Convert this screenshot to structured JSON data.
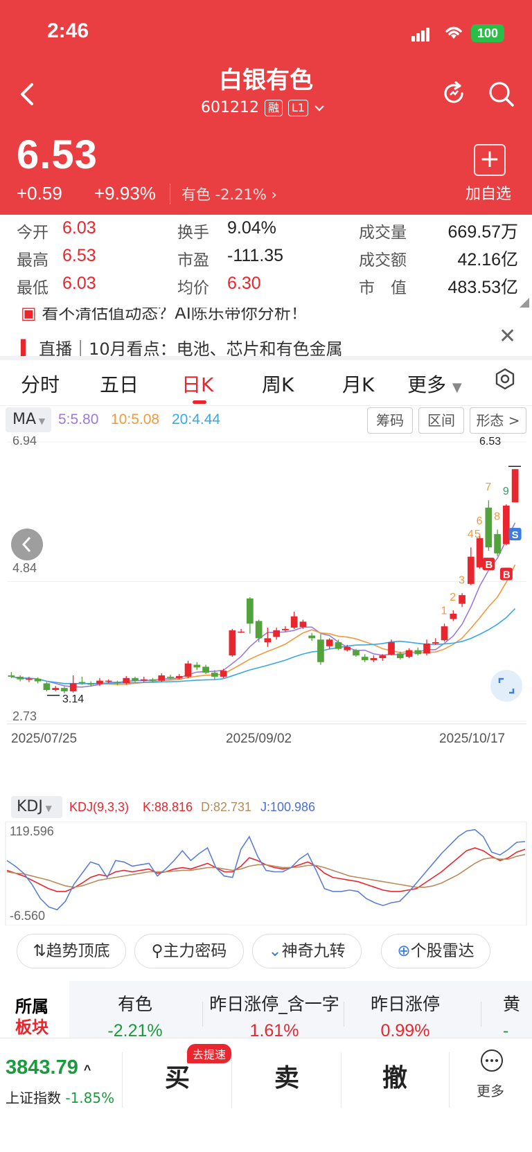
{
  "status": {
    "time": "2:46",
    "battery": "100"
  },
  "header": {
    "title": "白银有色",
    "code": "601212",
    "tags": [
      "融",
      "L1"
    ],
    "price": "6.53",
    "change_abs": "+0.59",
    "change_pct": "+9.93%",
    "sector_link": "有色  -2.21%",
    "add_label": "加自选"
  },
  "stats": [
    {
      "k": "今开",
      "v": "6.03",
      "color": "red"
    },
    {
      "k": "最高",
      "v": "6.53",
      "color": "red"
    },
    {
      "k": "最低",
      "v": "6.03",
      "color": "red"
    },
    {
      "k": "换手",
      "v": "9.04%",
      "color": "dark"
    },
    {
      "k": "市盈",
      "v": "-111.35",
      "color": "dark"
    },
    {
      "k": "均价",
      "v": "6.30",
      "color": "red"
    },
    {
      "k": "成交量",
      "v": "669.57万",
      "color": "dark"
    },
    {
      "k": "成交额",
      "v": "42.16亿",
      "color": "dark"
    },
    {
      "k": "市　值",
      "v": "483.53亿",
      "color": "dark"
    }
  ],
  "news": [
    "看不清估值动态？AI陈乐带你分析！",
    "直播｜10月看点：电池、芯片和有色金属"
  ],
  "tabs": [
    "分时",
    "五日",
    "日K",
    "周K",
    "月K",
    "更多"
  ],
  "ma": {
    "label": "MA",
    "ma5": "5:5.80",
    "ma10": "10:5.08",
    "ma20": "20:4.44"
  },
  "chips": [
    "筹码",
    "区间",
    "形态 >"
  ],
  "kdj": {
    "label": "KDJ",
    "params": "KDJ(9,3,3)",
    "k": "K:88.816",
    "d": "D:82.731",
    "j": "J:100.986"
  },
  "tools": [
    "趋势顶底",
    "主力密码",
    "神奇九转",
    "个股雷达"
  ],
  "sector": {
    "title": [
      "所属",
      "板块"
    ],
    "items": [
      {
        "name": "有色",
        "pct": "-2.21%",
        "color": "green"
      },
      {
        "name": "昨日涨停_含一字",
        "pct": "1.61%",
        "color": "red"
      },
      {
        "name": "昨日涨停",
        "pct": "0.99%",
        "color": "red"
      },
      {
        "name": "黄",
        "pct": "-",
        "color": "green"
      }
    ]
  },
  "bottom": {
    "index_value": "3843.79",
    "index_name": "上证指数",
    "index_change": "-1.85%",
    "buy": "买",
    "sell": "卖",
    "cancel": "撤",
    "fast_badge": "去提速",
    "more": "更多"
  },
  "chart_data": [
    {
      "type": "candlestick",
      "y_axis_labels": [
        "6.94",
        "4.84",
        "2.73"
      ],
      "y_range": [
        2.73,
        6.94
      ],
      "x_axis_labels": [
        "2025/07/25",
        "2025/09/02",
        "2025/10/17"
      ],
      "annotations": {
        "high_label": "6.53",
        "low_label": "3.14",
        "nine_turn": [
          "1",
          "2",
          "3",
          "4",
          "5",
          "6",
          "7",
          "8",
          "9"
        ],
        "signals": [
          "B",
          "B",
          "S"
        ]
      },
      "candles": [
        [
          3.42,
          3.4,
          3.47,
          3.38
        ],
        [
          3.4,
          3.36,
          3.42,
          3.33
        ],
        [
          3.36,
          3.37,
          3.4,
          3.32
        ],
        [
          3.37,
          3.33,
          3.39,
          3.3
        ],
        [
          3.3,
          3.2,
          3.32,
          3.18
        ],
        [
          3.2,
          3.23,
          3.26,
          3.18
        ],
        [
          3.23,
          3.18,
          3.25,
          3.15
        ],
        [
          3.18,
          3.3,
          3.42,
          3.16
        ],
        [
          3.32,
          3.31,
          3.4,
          3.28
        ],
        [
          3.3,
          3.28,
          3.33,
          3.25
        ],
        [
          3.29,
          3.34,
          3.38,
          3.26
        ],
        [
          3.33,
          3.34,
          3.36,
          3.3
        ],
        [
          3.32,
          3.3,
          3.34,
          3.27
        ],
        [
          3.3,
          3.38,
          3.41,
          3.28
        ],
        [
          3.38,
          3.34,
          3.4,
          3.32
        ],
        [
          3.34,
          3.36,
          3.4,
          3.32
        ],
        [
          3.36,
          3.34,
          3.38,
          3.31
        ],
        [
          3.34,
          3.42,
          3.45,
          3.32
        ],
        [
          3.4,
          3.38,
          3.43,
          3.36
        ],
        [
          3.38,
          3.41,
          3.44,
          3.36
        ],
        [
          3.4,
          3.6,
          3.64,
          3.38
        ],
        [
          3.58,
          3.54,
          3.62,
          3.5
        ],
        [
          3.55,
          3.46,
          3.58,
          3.44
        ],
        [
          3.46,
          3.4,
          3.5,
          3.36
        ],
        [
          3.4,
          3.49,
          3.52,
          3.38
        ],
        [
          3.72,
          4.1,
          4.12,
          3.7
        ],
        [
          4.08,
          4.08,
          4.12,
          4.06
        ],
        [
          4.58,
          4.2,
          4.6,
          4.05
        ],
        [
          4.24,
          3.98,
          4.26,
          3.92
        ],
        [
          3.92,
          3.98,
          4.14,
          3.85
        ],
        [
          4.0,
          4.1,
          4.14,
          3.96
        ],
        [
          4.1,
          4.12,
          4.16,
          4.08
        ],
        [
          4.14,
          4.31,
          4.38,
          4.12
        ],
        [
          4.15,
          4.23,
          4.26,
          4.12
        ],
        [
          4.02,
          3.98,
          4.06,
          3.94
        ],
        [
          3.96,
          3.62,
          4.04,
          3.58
        ],
        [
          3.86,
          3.96,
          3.98,
          3.82
        ],
        [
          3.92,
          3.82,
          3.96,
          3.8
        ],
        [
          3.8,
          3.85,
          3.88,
          3.78
        ],
        [
          3.8,
          3.72,
          3.82,
          3.7
        ],
        [
          3.7,
          3.65,
          3.74,
          3.62
        ],
        [
          3.65,
          3.68,
          3.72,
          3.62
        ],
        [
          3.68,
          3.72,
          3.74,
          3.64
        ],
        [
          3.73,
          3.92,
          3.96,
          3.72
        ],
        [
          3.75,
          3.68,
          3.78,
          3.66
        ],
        [
          3.7,
          3.8,
          3.83,
          3.68
        ],
        [
          3.8,
          3.74,
          3.84,
          3.72
        ],
        [
          3.75,
          3.9,
          3.96,
          3.72
        ],
        [
          3.9,
          3.92,
          3.98,
          3.88
        ],
        [
          3.95,
          4.16,
          4.2,
          3.93
        ],
        [
          4.27,
          4.35,
          4.4,
          4.24
        ],
        [
          4.5,
          4.63,
          4.66,
          4.45
        ],
        [
          4.8,
          5.21,
          5.35,
          4.78
        ],
        [
          5.05,
          5.49,
          5.55,
          5.03
        ],
        [
          5.95,
          5.35,
          6.06,
          5.3
        ],
        [
          5.55,
          5.26,
          5.62,
          5.22
        ],
        [
          5.4,
          5.98,
          6.0,
          5.38
        ],
        [
          6.03,
          6.53,
          6.53,
          6.03
        ]
      ]
    },
    {
      "type": "line",
      "title": "KDJ(9,3,3)",
      "y_axis_labels": [
        "119.596",
        "-6.560"
      ],
      "y_range": [
        -6.56,
        119.596
      ],
      "series": [
        {
          "name": "K",
          "values": [
            60,
            56,
            52,
            46,
            40,
            34,
            30,
            30,
            35,
            42,
            50,
            54,
            52,
            58,
            60,
            58,
            60,
            62,
            56,
            58,
            62,
            64,
            62,
            66,
            70,
            64,
            58,
            58,
            66,
            78,
            74,
            68,
            64,
            62,
            64,
            68,
            72,
            66,
            56,
            50,
            48,
            46,
            44,
            40,
            36,
            32,
            30,
            30,
            32,
            34,
            42,
            50,
            58,
            68,
            78,
            88,
            92,
            88,
            80,
            74,
            78,
            86,
            90
          ]
        },
        {
          "name": "D",
          "values": [
            58,
            56,
            55,
            52,
            49,
            46,
            42,
            38,
            36,
            38,
            42,
            46,
            48,
            50,
            52,
            54,
            56,
            58,
            58,
            58,
            59,
            60,
            60,
            62,
            64,
            64,
            62,
            60,
            62,
            66,
            68,
            68,
            66,
            64,
            64,
            65,
            67,
            67,
            64,
            60,
            56,
            52,
            50,
            48,
            46,
            44,
            42,
            40,
            38,
            36,
            36,
            38,
            42,
            48,
            54,
            62,
            70,
            76,
            78,
            76,
            76,
            80,
            82.7
          ]
        },
        {
          "name": "J",
          "values": [
            74,
            66,
            56,
            40,
            20,
            8,
            4,
            16,
            40,
            56,
            72,
            68,
            50,
            74,
            72,
            66,
            68,
            70,
            52,
            62,
            74,
            88,
            74,
            84,
            92,
            64,
            52,
            50,
            90,
            108,
            80,
            60,
            58,
            58,
            64,
            76,
            84,
            60,
            34,
            30,
            30,
            32,
            30,
            20,
            14,
            10,
            14,
            16,
            28,
            42,
            56,
            70,
            84,
            96,
            108,
            116,
            118,
            108,
            86,
            82,
            90,
            100,
            101
          ]
        }
      ]
    }
  ]
}
